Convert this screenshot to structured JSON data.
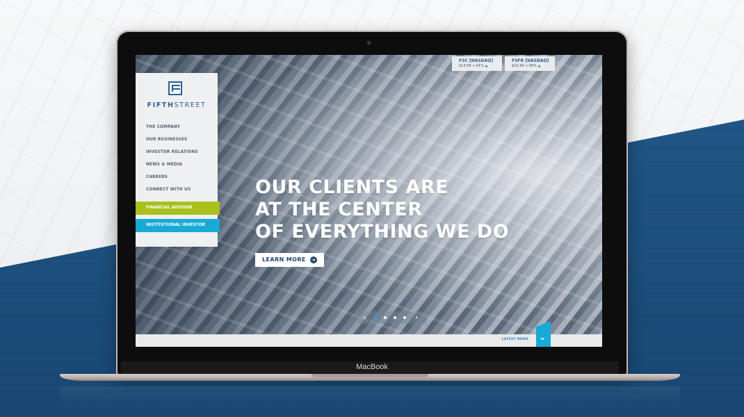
{
  "device": {
    "brand_label": "MacBook"
  },
  "site": {
    "logo": {
      "text_bold": "FIFTH",
      "text_light": "STREET"
    },
    "nav": {
      "items": [
        {
          "label": "THE COMPANY"
        },
        {
          "label": "OUR BUSINESSES"
        },
        {
          "label": "INVESTOR RELATIONS"
        },
        {
          "label": "NEWS & MEDIA"
        },
        {
          "label": "CAREERS"
        },
        {
          "label": "CONNECT WITH US"
        }
      ],
      "cta_advisor": "FINANCIAL ADVISOR",
      "cta_institutional": "INSTITUTIONAL INVESTOR"
    },
    "tickers": [
      {
        "symbol": "FSC [NASDAQ]",
        "price": "$13.59",
        "change": "+.01%"
      },
      {
        "symbol": "FSFR [NASDAQ]",
        "price": "$10.30",
        "change": "+.05%"
      }
    ],
    "hero": {
      "line1": "OUR CLIENTS ARE",
      "line2": "AT THE CENTER",
      "line3": "OF EVERYTHING WE DO",
      "button_label": "LEARN MORE"
    },
    "carousel": {
      "slides": 4,
      "active_index": 0,
      "prev_glyph": "‹",
      "next_glyph": "›"
    },
    "latest_news": {
      "label": "LATEST NEWS",
      "icon": "chevron-down-icon"
    },
    "colors": {
      "brand_blue": "#2a5f92",
      "advisor_green": "#a9c01d",
      "institutional_cyan": "#19a9d6",
      "background_blue": "#1f5485"
    }
  }
}
